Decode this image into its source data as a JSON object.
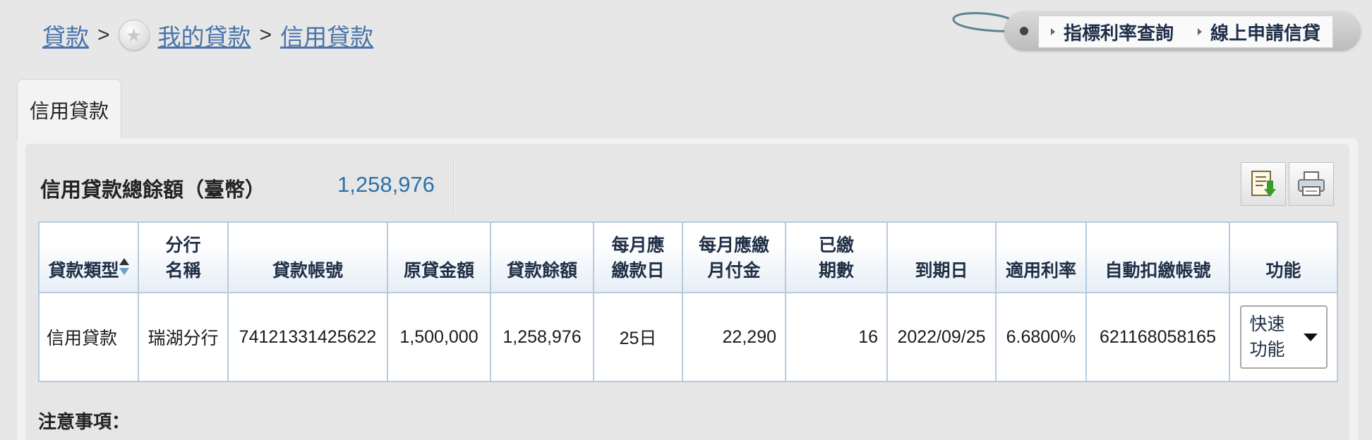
{
  "breadcrumb": {
    "items": [
      "貸款",
      "我的貸款",
      "信用貸款"
    ],
    "separator": ">"
  },
  "top_links": {
    "rate_query": "指標利率查詢",
    "apply_online": "線上申請信貸"
  },
  "tab": {
    "label": "信用貸款"
  },
  "summary": {
    "label": "信用貸款總餘額（臺幣）",
    "value": "1,258,976"
  },
  "toolbar": {
    "export_icon": "export-icon",
    "print_icon": "printer-icon"
  },
  "table": {
    "headers": [
      [
        "貸款類型"
      ],
      [
        "分行",
        "名稱"
      ],
      [
        "貸款帳號"
      ],
      [
        "原貸金額"
      ],
      [
        "貸款餘額"
      ],
      [
        "每月應",
        "繳款日"
      ],
      [
        "每月應繳",
        "月付金"
      ],
      [
        "已繳",
        "期數"
      ],
      [
        "到期日"
      ],
      [
        "適用利率"
      ],
      [
        "自動扣繳帳號"
      ],
      [
        "功能"
      ]
    ],
    "rows": [
      {
        "loan_type": "信用貸款",
        "branch": "瑞湖分行",
        "account": "74121331425622",
        "original_amount": "1,500,000",
        "balance": "1,258,976",
        "due_day": "25日",
        "monthly_payment": "22,290",
        "paid_periods": "16",
        "maturity": "2022/09/25",
        "rate": "6.6800%",
        "auto_debit_account": "621168058165",
        "action_line1": "快速",
        "action_line2": "功能"
      }
    ]
  },
  "notes": {
    "title": "注意事項："
  },
  "colors": {
    "background": "#e7e7e7",
    "link": "#4a74a8",
    "summary_value": "#2b71a8",
    "table_border": "#b6cbde"
  }
}
